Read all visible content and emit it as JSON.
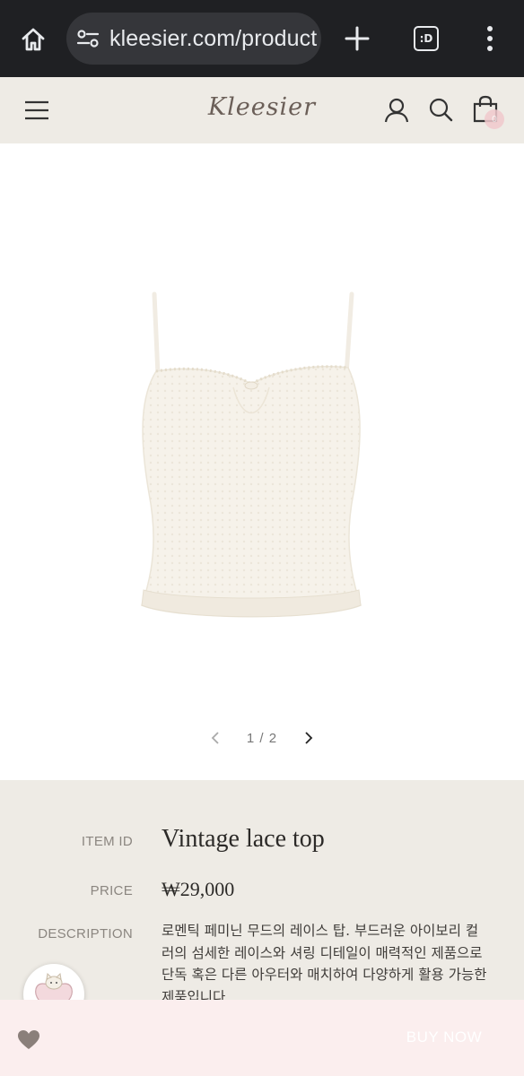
{
  "browser": {
    "url": "kleesier.com/product",
    "tabs_label": ":D"
  },
  "header": {
    "brand": "Kleesier",
    "cart_count": "0"
  },
  "gallery": {
    "current": "1",
    "total": "2",
    "counter": "1 / 2"
  },
  "product": {
    "item_id_label": "ITEM ID",
    "name": "Vintage lace top",
    "price_label": "PRICE",
    "price": "₩29,000",
    "description_label": "DESCRIPTION",
    "description": "로멘틱 페미닌 무드의 레이스 탑. 부드러운 아이보리 컬러의 섬세한 레이스와 셔링 디테일이 매력적인 제품으로 단독 혹은 다른 아우터와 매치하여 다양하게 활용 가능한 제품입니다."
  },
  "bottom_bar": {
    "buy_now": "BUY NOW"
  },
  "colors": {
    "header_bg": "#eeebe5",
    "bottom_bar_bg": "#fbeeee",
    "browser_bg": "#1f2023"
  }
}
